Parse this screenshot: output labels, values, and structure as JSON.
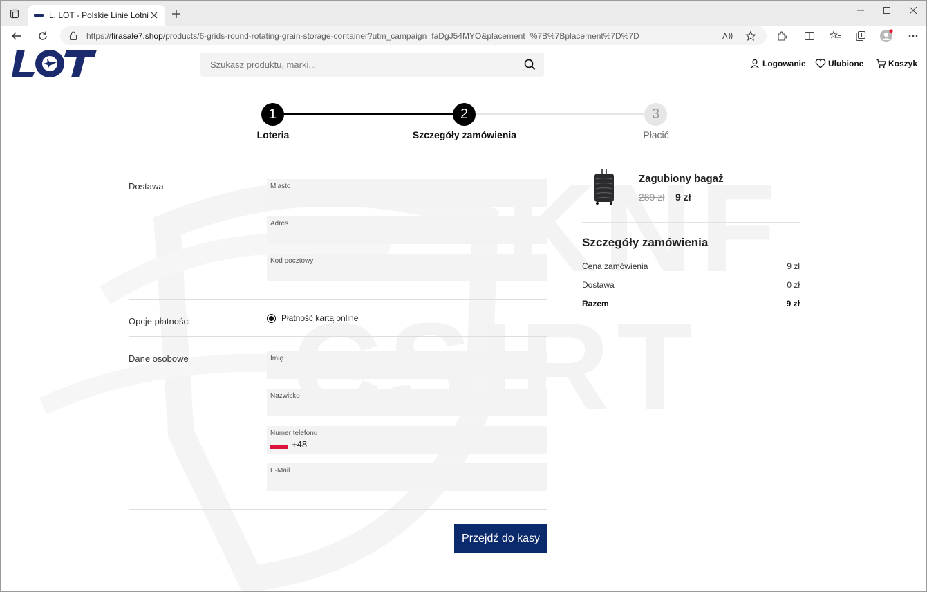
{
  "browser": {
    "tab_title": "L. LOT - Polskie Linie Lotnicze",
    "url_prefix": "https://",
    "url_domain": "firasale7.shop",
    "url_path": "/products/6-grids-round-rotating-grain-storage-container?utm_campaign=faDgJ54MYO&placement=%7B%7Bplacement%7D%7D"
  },
  "header": {
    "logo_text": "LOT",
    "search_placeholder": "Szukasz produktu, marki...",
    "login_label": "Logowanie",
    "favorites_label": "Ulubione",
    "cart_label": "Koszyk"
  },
  "steps": [
    {
      "number": "1",
      "label": "Loteria",
      "state": "done"
    },
    {
      "number": "2",
      "label": "Szczegóły zamówienia",
      "state": "active"
    },
    {
      "number": "3",
      "label": "Płacić",
      "state": "pending"
    }
  ],
  "form": {
    "delivery_label": "Dostawa",
    "city_label": "Miasto",
    "address_label": "Adres",
    "postal_label": "Kod pocztowy",
    "payment_label": "Opcje płatności",
    "payment_option": "Płatność kartą online",
    "personal_label": "Dane osobowe",
    "first_name_label": "Imię",
    "last_name_label": "Nazwisko",
    "phone_label": "Numer telefonu",
    "phone_prefix": "+48",
    "email_label": "E-Mail",
    "checkout_button": "Przejdź do kasy"
  },
  "summary": {
    "product_name": "Zagubiony bagaż",
    "old_price": "289 zł",
    "new_price": "9 zł",
    "title": "Szczegóły zamówienia",
    "rows": [
      {
        "label": "Cena zamówienia",
        "value": "9 zł"
      },
      {
        "label": "Dostawa",
        "value": "0 zł"
      },
      {
        "label": "Razem",
        "value": "9 zł"
      }
    ]
  },
  "watermark": {
    "line1": "KNF",
    "line2": "CSIRT"
  },
  "colors": {
    "brand": "#0b2a6b",
    "logo": "#1a2a6c",
    "step_done": "#000000",
    "step_pending": "#e6e6e6"
  }
}
